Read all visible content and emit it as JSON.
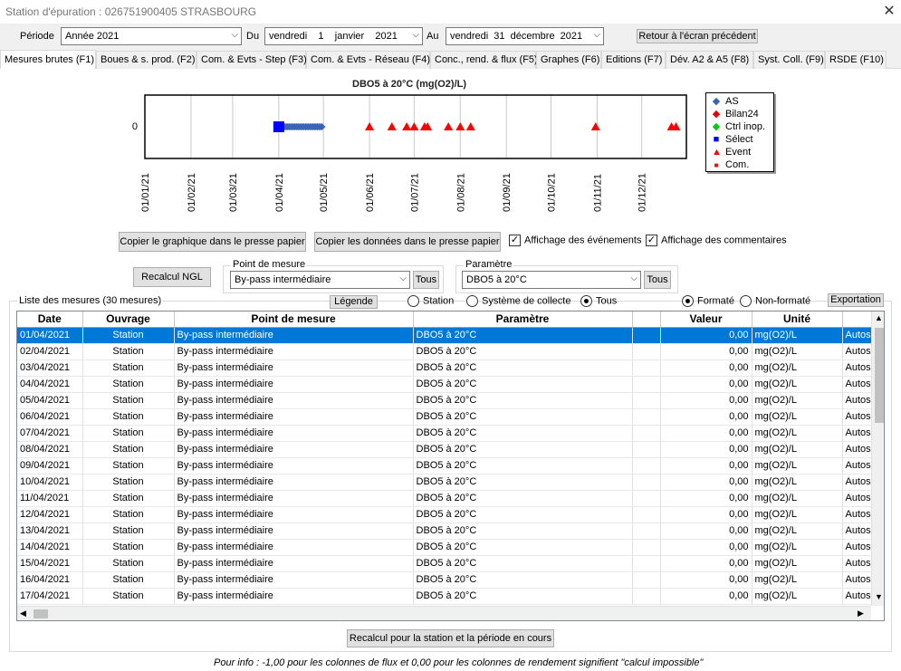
{
  "window": {
    "title": "Station d'épuration : 026751900405 STRASBOURG"
  },
  "toolbar": {
    "periode_label": "Période",
    "periode_value": "Année 2021",
    "du_label": "Du",
    "du_value": "vendredi    1    janvier    2021",
    "au_label": "Au",
    "au_value": "vendredi  31  décembre  2021",
    "back_button": "Retour à l'écran précédent"
  },
  "tabs": [
    "Mesures brutes (F1)",
    "Boues & s. prod. (F2)",
    "Com. & Evts - Step (F3)",
    "Com. & Evts - Réseau (F4)",
    "Conc., rend. & flux (F5)",
    "Graphes (F6)",
    "Editions (F7)",
    "Dév. A2 & A5 (F8)",
    "Syst. Coll. (F9)",
    "RSDE (F10)"
  ],
  "chart_data": {
    "type": "scatter",
    "title": "DBO5 à 20°C (mg(O2)/L)",
    "xlabel": "",
    "ylabel": "",
    "ytick": "0",
    "x_ticks": [
      "01/01/21",
      "01/02/21",
      "01/03/21",
      "01/04/21",
      "01/05/21",
      "01/06/21",
      "01/07/21",
      "01/08/21",
      "01/09/21",
      "01/10/21",
      "01/11/21",
      "01/12/21"
    ],
    "x_range": [
      "2021-01-01",
      "2021-12-31"
    ],
    "series": [
      {
        "name": "AS",
        "color": "#3c64b4",
        "marker": "diamond",
        "x": [
          "2021-04-01",
          "2021-04-02",
          "2021-04-03",
          "2021-04-04",
          "2021-04-05",
          "2021-04-06",
          "2021-04-07",
          "2021-04-08",
          "2021-04-09",
          "2021-04-10",
          "2021-04-11",
          "2021-04-12",
          "2021-04-13",
          "2021-04-14",
          "2021-04-15",
          "2021-04-16",
          "2021-04-17",
          "2021-04-18",
          "2021-04-19",
          "2021-04-20",
          "2021-04-21",
          "2021-04-22",
          "2021-04-23",
          "2021-04-24",
          "2021-04-25",
          "2021-04-26",
          "2021-04-27",
          "2021-04-28",
          "2021-04-29",
          "2021-04-30"
        ],
        "y": [
          0,
          0,
          0,
          0,
          0,
          0,
          0,
          0,
          0,
          0,
          0,
          0,
          0,
          0,
          0,
          0,
          0,
          0,
          0,
          0,
          0,
          0,
          0,
          0,
          0,
          0,
          0,
          0,
          0,
          0
        ]
      },
      {
        "name": "Bilan24",
        "color": "#e00000",
        "marker": "diamond",
        "x": [],
        "y": []
      },
      {
        "name": "Ctrl inop.",
        "color": "#00cc00",
        "marker": "diamond",
        "x": [],
        "y": []
      },
      {
        "name": "Sélect",
        "color": "#0000ff",
        "marker": "square",
        "x": [
          "2021-04-01"
        ],
        "y": [
          0
        ]
      },
      {
        "name": "Event",
        "color": "#ff0000",
        "marker": "triangle",
        "x": [
          "2021-06-01",
          "2021-06-16",
          "2021-06-26",
          "2021-07-01",
          "2021-07-08",
          "2021-07-10",
          "2021-07-24",
          "2021-08-01",
          "2021-08-08",
          "2021-10-31",
          "2021-12-21",
          "2021-12-24"
        ],
        "y": [
          0,
          0,
          0,
          0,
          0,
          0,
          0,
          0,
          0,
          0,
          0,
          0
        ]
      },
      {
        "name": "Com.",
        "color": "#ff0000",
        "marker": "small-square",
        "x": [],
        "y": []
      }
    ],
    "legend_position": "right",
    "grid": true
  },
  "actions": {
    "copy_chart": "Copier le graphique dans le presse papier",
    "copy_data": "Copier les données dans le presse papier",
    "show_events": "Affichage des événements",
    "show_comments": "Affichage des commentaires",
    "recalc_ngl": "Recalcul NGL",
    "point_label": "Point de mesure",
    "point_value": "By-pass intermédiaire",
    "tous": "Tous",
    "param_label": "Paramètre",
    "param_value": "DBO5 à 20°C"
  },
  "list": {
    "title": "Liste des mesures (30 mesures)",
    "legend_button": "Légende",
    "radio_station": "Station",
    "radio_systeme": "Système de collecte",
    "radio_tous": "Tous",
    "radio_formate": "Formaté",
    "radio_nonformate": "Non-formaté",
    "export_button": "Exportation",
    "columns": [
      "Date",
      "Ouvrage",
      "Point de mesure",
      "Paramètre",
      "",
      "Valeur",
      "Unité",
      ""
    ],
    "rows": [
      [
        "01/04/2021",
        "Station",
        "By-pass intermédiaire",
        "DBO5 à 20°C",
        "",
        "0,00",
        "mg(O2)/L",
        "Autos"
      ],
      [
        "02/04/2021",
        "Station",
        "By-pass intermédiaire",
        "DBO5 à 20°C",
        "",
        "0,00",
        "mg(O2)/L",
        "Autos"
      ],
      [
        "03/04/2021",
        "Station",
        "By-pass intermédiaire",
        "DBO5 à 20°C",
        "",
        "0,00",
        "mg(O2)/L",
        "Autos"
      ],
      [
        "04/04/2021",
        "Station",
        "By-pass intermédiaire",
        "DBO5 à 20°C",
        "",
        "0,00",
        "mg(O2)/L",
        "Autos"
      ],
      [
        "05/04/2021",
        "Station",
        "By-pass intermédiaire",
        "DBO5 à 20°C",
        "",
        "0,00",
        "mg(O2)/L",
        "Autos"
      ],
      [
        "06/04/2021",
        "Station",
        "By-pass intermédiaire",
        "DBO5 à 20°C",
        "",
        "0,00",
        "mg(O2)/L",
        "Autos"
      ],
      [
        "07/04/2021",
        "Station",
        "By-pass intermédiaire",
        "DBO5 à 20°C",
        "",
        "0,00",
        "mg(O2)/L",
        "Autos"
      ],
      [
        "08/04/2021",
        "Station",
        "By-pass intermédiaire",
        "DBO5 à 20°C",
        "",
        "0,00",
        "mg(O2)/L",
        "Autos"
      ],
      [
        "09/04/2021",
        "Station",
        "By-pass intermédiaire",
        "DBO5 à 20°C",
        "",
        "0,00",
        "mg(O2)/L",
        "Autos"
      ],
      [
        "10/04/2021",
        "Station",
        "By-pass intermédiaire",
        "DBO5 à 20°C",
        "",
        "0,00",
        "mg(O2)/L",
        "Autos"
      ],
      [
        "11/04/2021",
        "Station",
        "By-pass intermédiaire",
        "DBO5 à 20°C",
        "",
        "0,00",
        "mg(O2)/L",
        "Autos"
      ],
      [
        "12/04/2021",
        "Station",
        "By-pass intermédiaire",
        "DBO5 à 20°C",
        "",
        "0,00",
        "mg(O2)/L",
        "Autos"
      ],
      [
        "13/04/2021",
        "Station",
        "By-pass intermédiaire",
        "DBO5 à 20°C",
        "",
        "0,00",
        "mg(O2)/L",
        "Autos"
      ],
      [
        "14/04/2021",
        "Station",
        "By-pass intermédiaire",
        "DBO5 à 20°C",
        "",
        "0,00",
        "mg(O2)/L",
        "Autos"
      ],
      [
        "15/04/2021",
        "Station",
        "By-pass intermédiaire",
        "DBO5 à 20°C",
        "",
        "0,00",
        "mg(O2)/L",
        "Autos"
      ],
      [
        "16/04/2021",
        "Station",
        "By-pass intermédiaire",
        "DBO5 à 20°C",
        "",
        "0,00",
        "mg(O2)/L",
        "Autos"
      ],
      [
        "17/04/2021",
        "Station",
        "By-pass intermédiaire",
        "DBO5 à 20°C",
        "",
        "0,00",
        "mg(O2)/L",
        "Autos"
      ]
    ]
  },
  "bottom": {
    "recalc_button": "Recalcul pour la station et la période en cours",
    "note": "Pour info : -1,00 pour les colonnes de flux et 0,00 pour les colonnes de rendement signifient \"calcul impossible\""
  }
}
